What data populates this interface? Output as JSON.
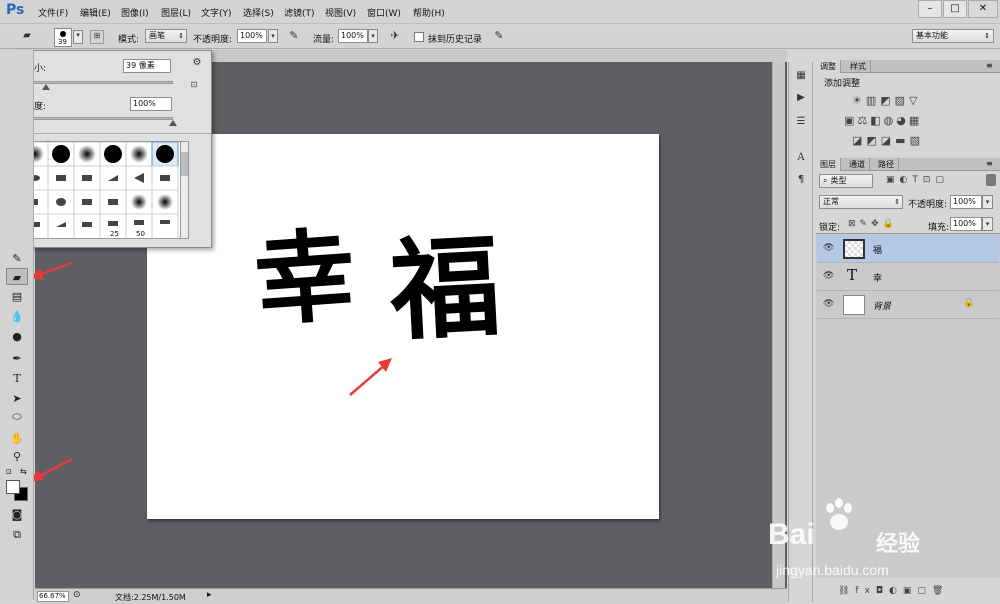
{
  "app": {
    "logo": "Ps"
  },
  "menu": [
    "文件(F)",
    "编辑(E)",
    "图像(I)",
    "图层(L)",
    "文字(Y)",
    "选择(S)",
    "滤镜(T)",
    "视图(V)",
    "窗口(W)",
    "帮助(H)"
  ],
  "window_controls": {
    "minimize": "–",
    "restore": "□",
    "close": "✕"
  },
  "options_bar": {
    "brush_size": "39",
    "mode_label": "模式:",
    "mode_value": "画笔",
    "opacity_label": "不透明度:",
    "opacity_value": "100%",
    "flow_label": "流量:",
    "flow_value": "100%",
    "history_label": "抹到历史记录",
    "workspace": "基本功能"
  },
  "brush_panel": {
    "size_label": "大小:",
    "size_value": "39 像素",
    "hardness_label": "硬度:",
    "hardness_value": "100%",
    "size_fraction": 0.14,
    "hardness_fraction": 1.0,
    "preset_numbers": [
      "25",
      "50"
    ]
  },
  "document": {
    "text1": "幸",
    "text2": "福"
  },
  "status": {
    "zoom": "66.67%",
    "doc_info": "文档:2.25M/1.50M"
  },
  "adjustments_panel": {
    "tabs": [
      "调整",
      "样式"
    ],
    "title": "添加调整"
  },
  "layers_panel": {
    "tabs": [
      "图层",
      "通道",
      "路径"
    ],
    "filter_kind": "类型",
    "blend_mode": "正常",
    "opacity_label": "不透明度:",
    "opacity_value": "100%",
    "lock_label": "锁定:",
    "fill_label": "填充:",
    "fill_value": "100%",
    "layers": [
      {
        "name": "福",
        "type": "pixel",
        "selected": true
      },
      {
        "name": "幸",
        "type": "text",
        "selected": false
      },
      {
        "name": "背景",
        "type": "background",
        "selected": false
      }
    ]
  },
  "watermark": {
    "brand": "Bai",
    "brand2": "经验",
    "url": "jingyan.baidu.com"
  }
}
